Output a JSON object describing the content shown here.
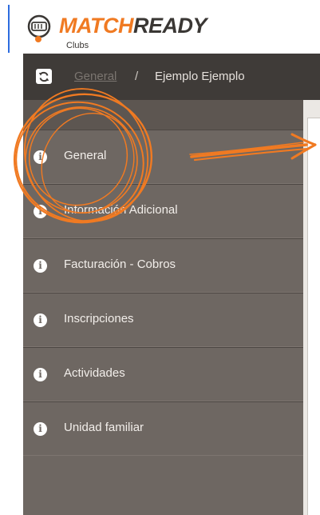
{
  "brand": {
    "name_part1": "MATCH",
    "name_part2": "READY",
    "subtitle": "Clubs",
    "icon": "ticket-logo-icon",
    "colors": {
      "orange": "#f07a22",
      "dark": "#3a3734"
    }
  },
  "breadcrumb": {
    "refresh_icon": "refresh-icon",
    "items": [
      "General",
      "Ejemplo Ejemplo"
    ],
    "separator": "/"
  },
  "sidebar": {
    "items": [
      {
        "label": "General",
        "icon": "info-icon"
      },
      {
        "label": "Información Adicional",
        "icon": "info-icon"
      },
      {
        "label": "Facturación - Cobros",
        "icon": "info-icon"
      },
      {
        "label": "Inscripciones",
        "icon": "info-icon"
      },
      {
        "label": "Actividades",
        "icon": "info-icon"
      },
      {
        "label": "Unidad familiar",
        "icon": "info-icon"
      }
    ]
  },
  "annotation_color": "#f07a22"
}
